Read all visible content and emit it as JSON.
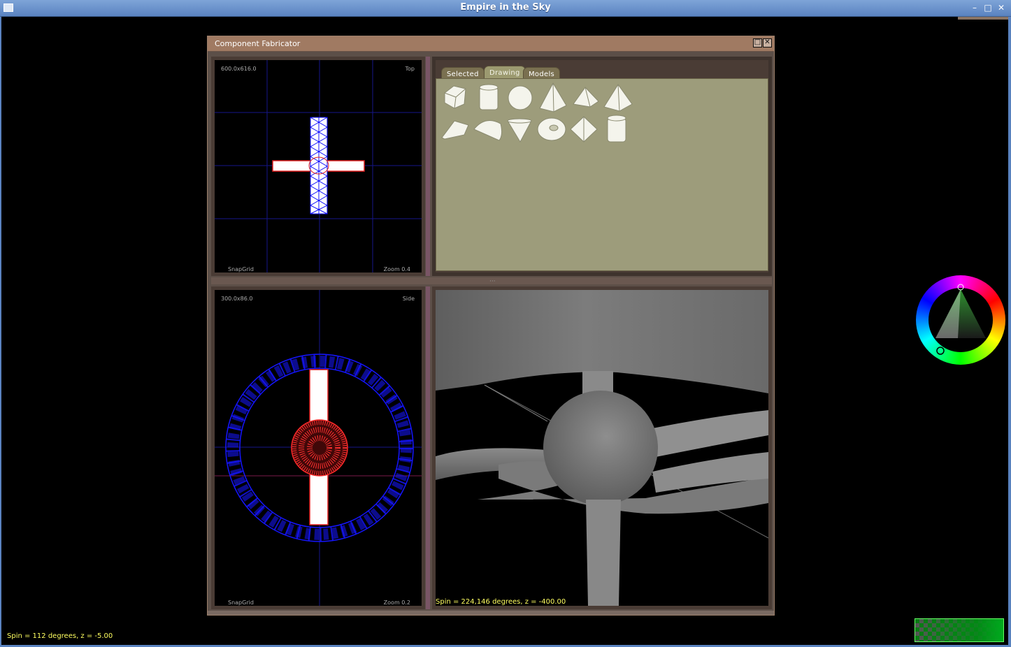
{
  "window": {
    "title": "Empire in the Sky",
    "controls": [
      "minimize-icon",
      "maximize-icon",
      "close-icon"
    ]
  },
  "fabricator": {
    "title": "Component Fabricator",
    "top_view": {
      "size": "600.0x616.0",
      "name": "Top",
      "snap": "SnapGrid",
      "zoom": "Zoom 0.4"
    },
    "side_view": {
      "size": "300.0x86.0",
      "name": "Side",
      "snap": "SnapGrid",
      "zoom": "Zoom 0.2"
    },
    "tabs": [
      {
        "label": "Selected",
        "active": false
      },
      {
        "label": "Drawing",
        "active": true
      },
      {
        "label": "Models",
        "active": false
      }
    ],
    "shapes": [
      "prism-icon",
      "cylinder-icon",
      "sphere-icon",
      "pyramid-icon",
      "flat-pyramid-icon",
      "tetrahedron-icon",
      "wedge-icon",
      "half-disc-icon",
      "cone-icon",
      "torus-icon",
      "diamond-icon",
      "short-cylinder-icon"
    ],
    "render_status": "Spin = 224,146 degrees, z = -400.00"
  },
  "status": "Spin = 112 degrees, z = -5.00",
  "colors": {
    "accent": "#a07a62",
    "wire_blue": "#1010ff",
    "wire_red": "#ff2020",
    "panel": "#9d9c7b"
  }
}
